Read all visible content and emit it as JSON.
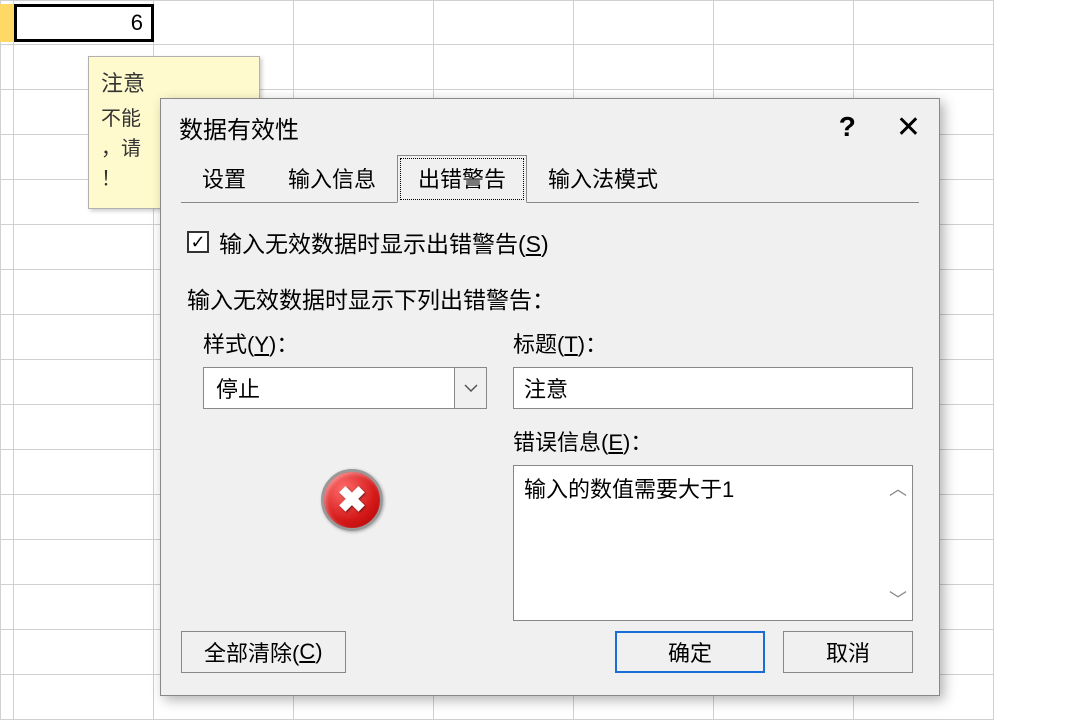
{
  "cell": {
    "value": "6"
  },
  "tooltip": {
    "title": "注意",
    "line1": "不能",
    "line2": "，请",
    "line3": "！"
  },
  "dialog": {
    "title": "数据有效性",
    "tabs": {
      "settings": "设置",
      "input_msg": "输入信息",
      "error_alert": "出错警告",
      "ime_mode": "输入法模式"
    },
    "checkbox_label_pre": "输入无效数据时显示出错警告(",
    "checkbox_label_key": "S",
    "checkbox_label_post": ")",
    "section_label": "输入无效数据时显示下列出错警告：",
    "style_label_pre": "样式(",
    "style_label_key": "Y",
    "style_label_post": ")：",
    "style_value": "停止",
    "title_label_pre": "标题(",
    "title_label_key": "T",
    "title_label_post": ")：",
    "title_value": "注意",
    "error_msg_label_pre": "错误信息(",
    "error_msg_label_key": "E",
    "error_msg_label_post": ")：",
    "error_msg_value": "输入的数值需要大于1",
    "buttons": {
      "clear_pre": "全部清除(",
      "clear_key": "C",
      "clear_post": ")",
      "ok": "确定",
      "cancel": "取消"
    }
  }
}
